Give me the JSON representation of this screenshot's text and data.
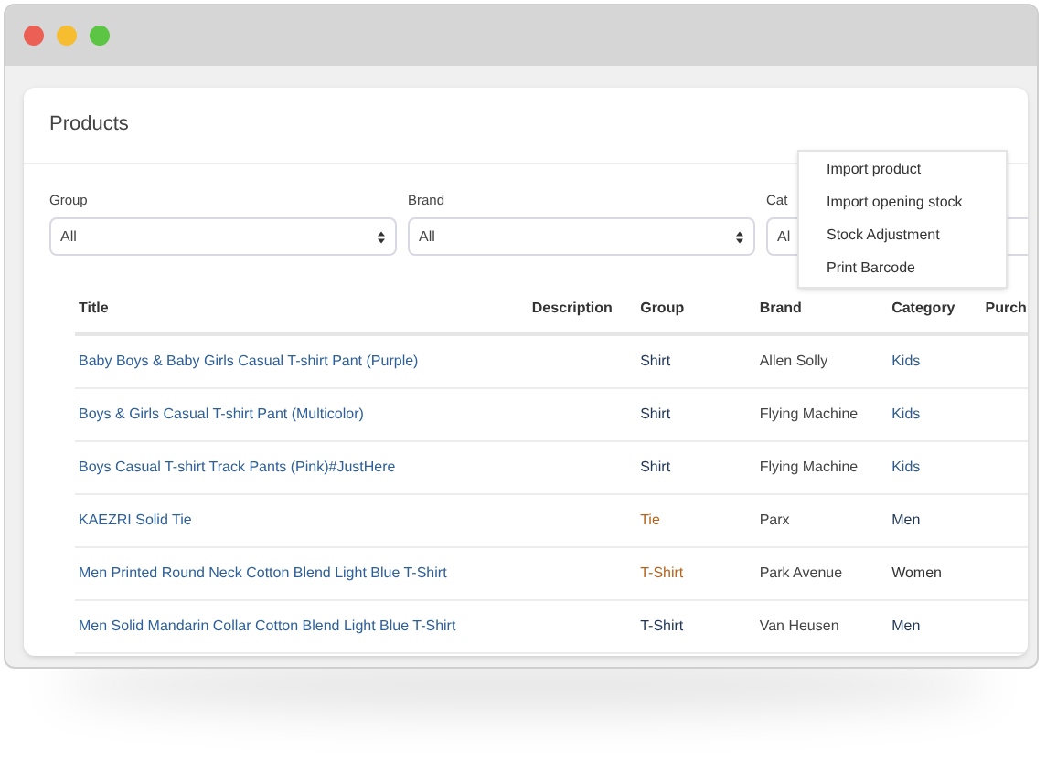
{
  "page": {
    "title": "Products"
  },
  "filters": [
    {
      "label": "Group",
      "value": "All"
    },
    {
      "label": "Brand",
      "value": "All"
    },
    {
      "label": "Cat",
      "value": "Al"
    }
  ],
  "menu": [
    "Import product",
    "Import opening stock",
    "Stock Adjustment",
    "Print Barcode"
  ],
  "table": {
    "columns": [
      "Title",
      "Description",
      "Group",
      "Brand",
      "Category",
      "Purch"
    ],
    "rows": [
      {
        "title": "Baby Boys & Baby Girls Casual T-shirt Pant (Purple)",
        "group": {
          "text": "Shirt",
          "color": "#1f3556"
        },
        "brand": "Allen Solly",
        "category": {
          "text": "Kids",
          "color": "#2e5c8e"
        }
      },
      {
        "title": "Boys & Girls Casual T-shirt Pant (Multicolor)",
        "group": {
          "text": "Shirt",
          "color": "#1f3556"
        },
        "brand": "Flying Machine",
        "category": {
          "text": "Kids",
          "color": "#2e5c8e"
        }
      },
      {
        "title": "Boys Casual T-shirt Track Pants (Pink)#JustHere",
        "group": {
          "text": "Shirt",
          "color": "#1f3556"
        },
        "brand": "Flying Machine",
        "category": {
          "text": "Kids",
          "color": "#2e5c8e"
        }
      },
      {
        "title": "KAEZRI Solid Tie",
        "group": {
          "text": "Tie",
          "color": "#b5651d"
        },
        "brand": "Parx",
        "category": {
          "text": "Men",
          "color": "#1f3556"
        }
      },
      {
        "title": "Men Printed Round Neck Cotton Blend Light Blue T-Shirt",
        "group": {
          "text": "T-Shirt",
          "color": "#b5651d"
        },
        "brand": "Park Avenue",
        "category": {
          "text": "Women",
          "color": "#333333"
        }
      },
      {
        "title": "Men Solid Mandarin Collar Cotton Blend Light Blue T-Shirt",
        "group": {
          "text": "T-Shirt",
          "color": "#1f3556"
        },
        "brand": "Van Heusen",
        "category": {
          "text": "Men",
          "color": "#1f3556"
        }
      }
    ]
  }
}
